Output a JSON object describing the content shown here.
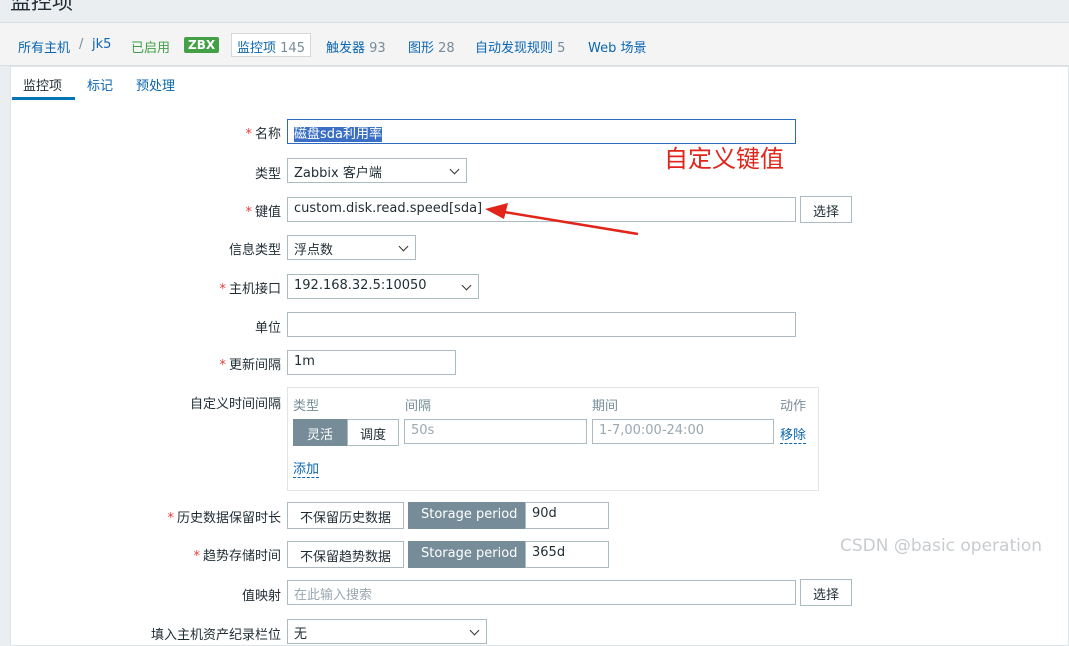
{
  "page": {
    "title": "监控项"
  },
  "breadcrumb": {
    "all_hosts": "所有主机",
    "separator": "/",
    "host": "jk5",
    "enabled": "已启用",
    "zbx": "ZBX",
    "items_label": "监控项",
    "items_count": "145",
    "triggers_label": "触发器",
    "triggers_count": "93",
    "graphs_label": "图形",
    "graphs_count": "28",
    "discovery_label": "自动发现规则",
    "discovery_count": "5",
    "web_label": "Web 场景"
  },
  "tabs": [
    {
      "label": "监控项",
      "active": true
    },
    {
      "label": "标记",
      "active": false
    },
    {
      "label": "预处理",
      "active": false
    }
  ],
  "form": {
    "name_label": "名称",
    "name_value": "磁盘sda利用率",
    "type_label": "类型",
    "type_value": "Zabbix 客户端",
    "key_label": "键值",
    "key_value": "custom.disk.read.speed[sda]",
    "select_button": "选择",
    "info_type_label": "信息类型",
    "info_type_value": "浮点数",
    "interface_label": "主机接口",
    "interface_value": "192.168.32.5:10050",
    "units_label": "单位",
    "units_value": "",
    "interval_label": "更新间隔",
    "interval_value": "1m",
    "custom_intervals_label": "自定义时间间隔",
    "custom_intervals": {
      "col_type": "类型",
      "col_interval": "间隔",
      "col_period": "期间",
      "col_action": "动作",
      "flexible": "灵活",
      "scheduling": "调度",
      "interval_placeholder": "50s",
      "period_placeholder": "1-7,00:00-24:00",
      "remove": "移除",
      "add": "添加"
    },
    "history_label": "历史数据保留时长",
    "history_no_keep": "不保留历史数据",
    "history_storage": "Storage period",
    "history_value": "90d",
    "trends_label": "趋势存储时间",
    "trends_no_keep": "不保留趋势数据",
    "trends_storage": "Storage period",
    "trends_value": "365d",
    "valuemap_label": "值映射",
    "valuemap_placeholder": "在此输入搜索",
    "valuemap_select": "选择",
    "inventory_label": "填入主机资产纪录栏位",
    "inventory_value": "无"
  },
  "annotation": {
    "text": "自定义键值",
    "color": "#e1251b"
  },
  "watermark": "CSDN @basic operation"
}
